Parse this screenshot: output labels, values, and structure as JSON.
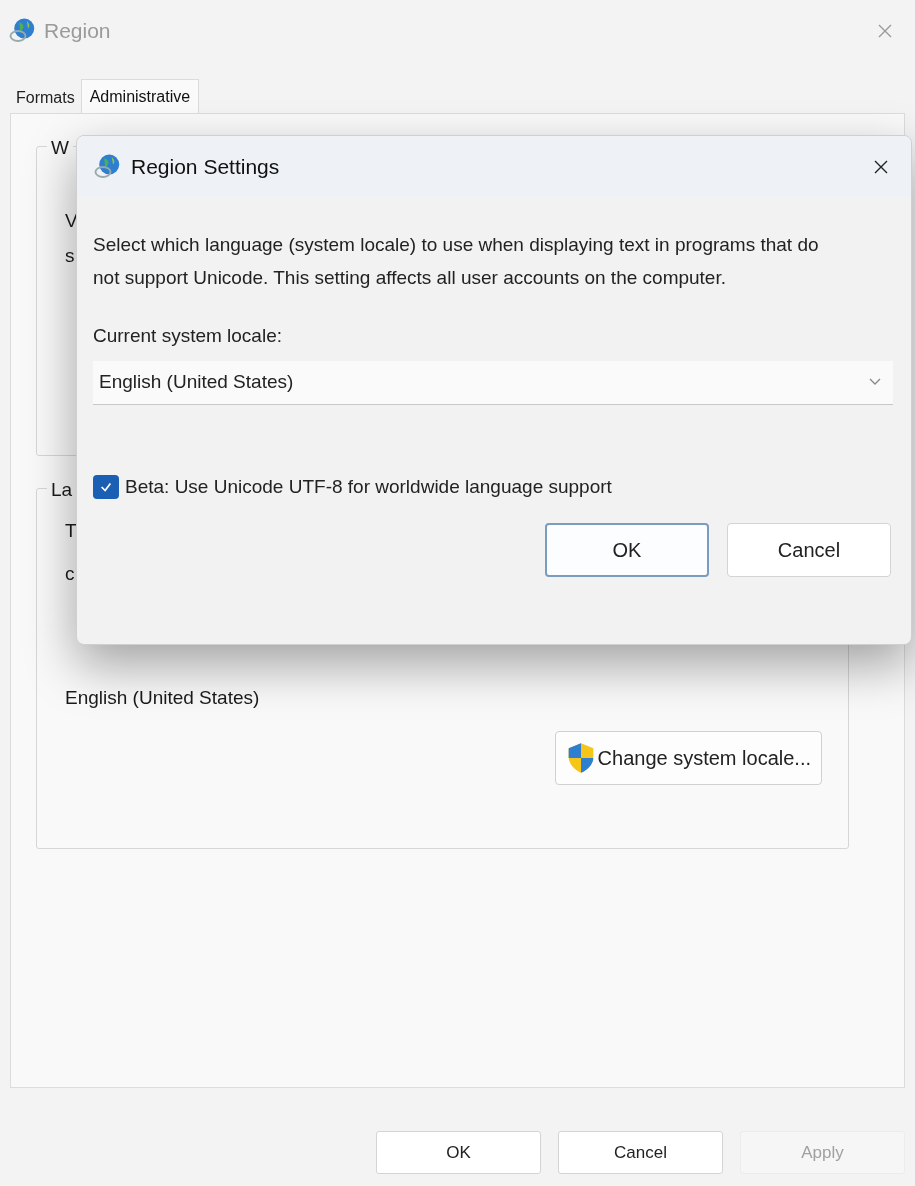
{
  "window": {
    "title": "Region"
  },
  "tabs": [
    {
      "label": "Formats",
      "selected": false
    },
    {
      "label": "Administrative",
      "selected": true
    }
  ],
  "groups": [
    {
      "label": "W",
      "lines": [
        "V",
        "s"
      ]
    },
    {
      "label": "La",
      "lines": [
        "T",
        "c"
      ],
      "value": "English (United States)",
      "button": "Change system locale..."
    }
  ],
  "dialog": {
    "title": "Region Settings",
    "description": "Select which language (system locale) to use when displaying text in programs that do not support Unicode. This setting affects all user accounts on the computer.",
    "locale_label": "Current system locale:",
    "locale_value": "English (United States)",
    "utf8_checkbox": {
      "label": "Beta: Use Unicode UTF-8 for worldwide language support",
      "checked": true
    },
    "buttons": [
      {
        "label": "OK",
        "default": true
      },
      {
        "label": "Cancel",
        "default": false
      }
    ]
  },
  "buttons": [
    {
      "label": "OK",
      "disabled": false
    },
    {
      "label": "Cancel",
      "disabled": false
    },
    {
      "label": "Apply",
      "disabled": true
    }
  ]
}
